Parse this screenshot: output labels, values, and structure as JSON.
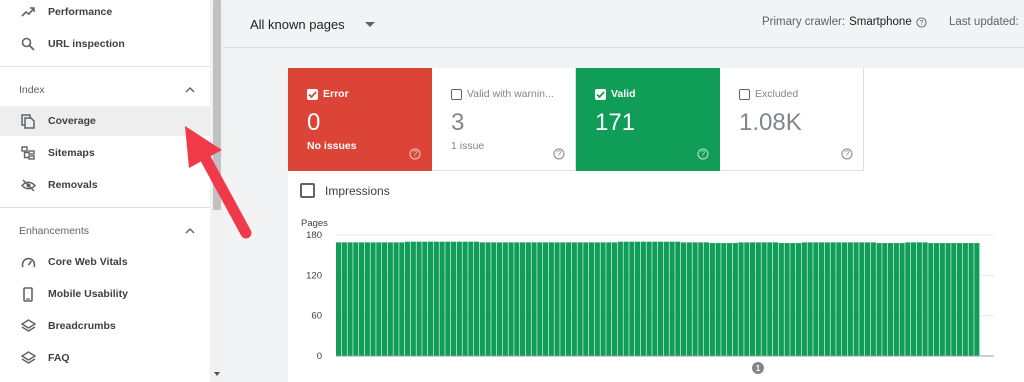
{
  "sidebar": {
    "items_top": [
      {
        "label": "Performance",
        "icon": "trending-up-icon"
      },
      {
        "label": "URL inspection",
        "icon": "search-icon"
      }
    ],
    "index": {
      "title": "Index",
      "items": [
        {
          "label": "Coverage",
          "icon": "file-copy-icon",
          "active": true
        },
        {
          "label": "Sitemaps",
          "icon": "sitemap-icon"
        },
        {
          "label": "Removals",
          "icon": "eye-off-icon"
        }
      ]
    },
    "enhancements": {
      "title": "Enhancements",
      "items": [
        {
          "label": "Core Web Vitals",
          "icon": "speedometer-icon"
        },
        {
          "label": "Mobile Usability",
          "icon": "smartphone-icon"
        },
        {
          "label": "Breadcrumbs",
          "icon": "layers-icon"
        },
        {
          "label": "FAQ",
          "icon": "layers-icon"
        }
      ]
    }
  },
  "topbar": {
    "page_filter": "All known pages",
    "crawler_label": "Primary crawler:",
    "crawler_value": "Smartphone",
    "last_updated_label": "Last updated:"
  },
  "tiles": {
    "error": {
      "title": "Error",
      "value": "0",
      "sub": "No issues",
      "color": "#db4437",
      "checked": true
    },
    "warning": {
      "title": "Valid with warnin...",
      "value": "3",
      "sub": "1 issue",
      "checked": false
    },
    "valid": {
      "title": "Valid",
      "value": "171",
      "sub": "",
      "color": "#0f9d58",
      "checked": true
    },
    "excluded": {
      "title": "Excluded",
      "value": "1.08K",
      "sub": "",
      "checked": false
    }
  },
  "impressions_label": "Impressions",
  "chart_data": {
    "type": "bar",
    "ylabel": "Pages",
    "yticks": [
      0,
      60,
      120,
      180
    ],
    "ylim": [
      0,
      180
    ],
    "annotation": "1",
    "color": "#0f9d58",
    "values": [
      169,
      169,
      169,
      169,
      169,
      169,
      169,
      169,
      169,
      169,
      169,
      169,
      170,
      170,
      170,
      170,
      170,
      170,
      170,
      170,
      170,
      170,
      170,
      170,
      170,
      169,
      169,
      169,
      169,
      169,
      169,
      169,
      169,
      169,
      169,
      169,
      169,
      169,
      169,
      169,
      169,
      169,
      169,
      169,
      169,
      169,
      169,
      169,
      169,
      170,
      170,
      170,
      170,
      170,
      170,
      170,
      170,
      170,
      170,
      170,
      169,
      169,
      169,
      169,
      169,
      168,
      168,
      168,
      168,
      168,
      169,
      169,
      169,
      169,
      169,
      169,
      169,
      168,
      168,
      168,
      168,
      169,
      169,
      169,
      169,
      169,
      169,
      169,
      169,
      169,
      169,
      169,
      169,
      169,
      168,
      168,
      168,
      168,
      168,
      169,
      169,
      169,
      169,
      168,
      168,
      168,
      168,
      168,
      168,
      168,
      168,
      168
    ]
  }
}
